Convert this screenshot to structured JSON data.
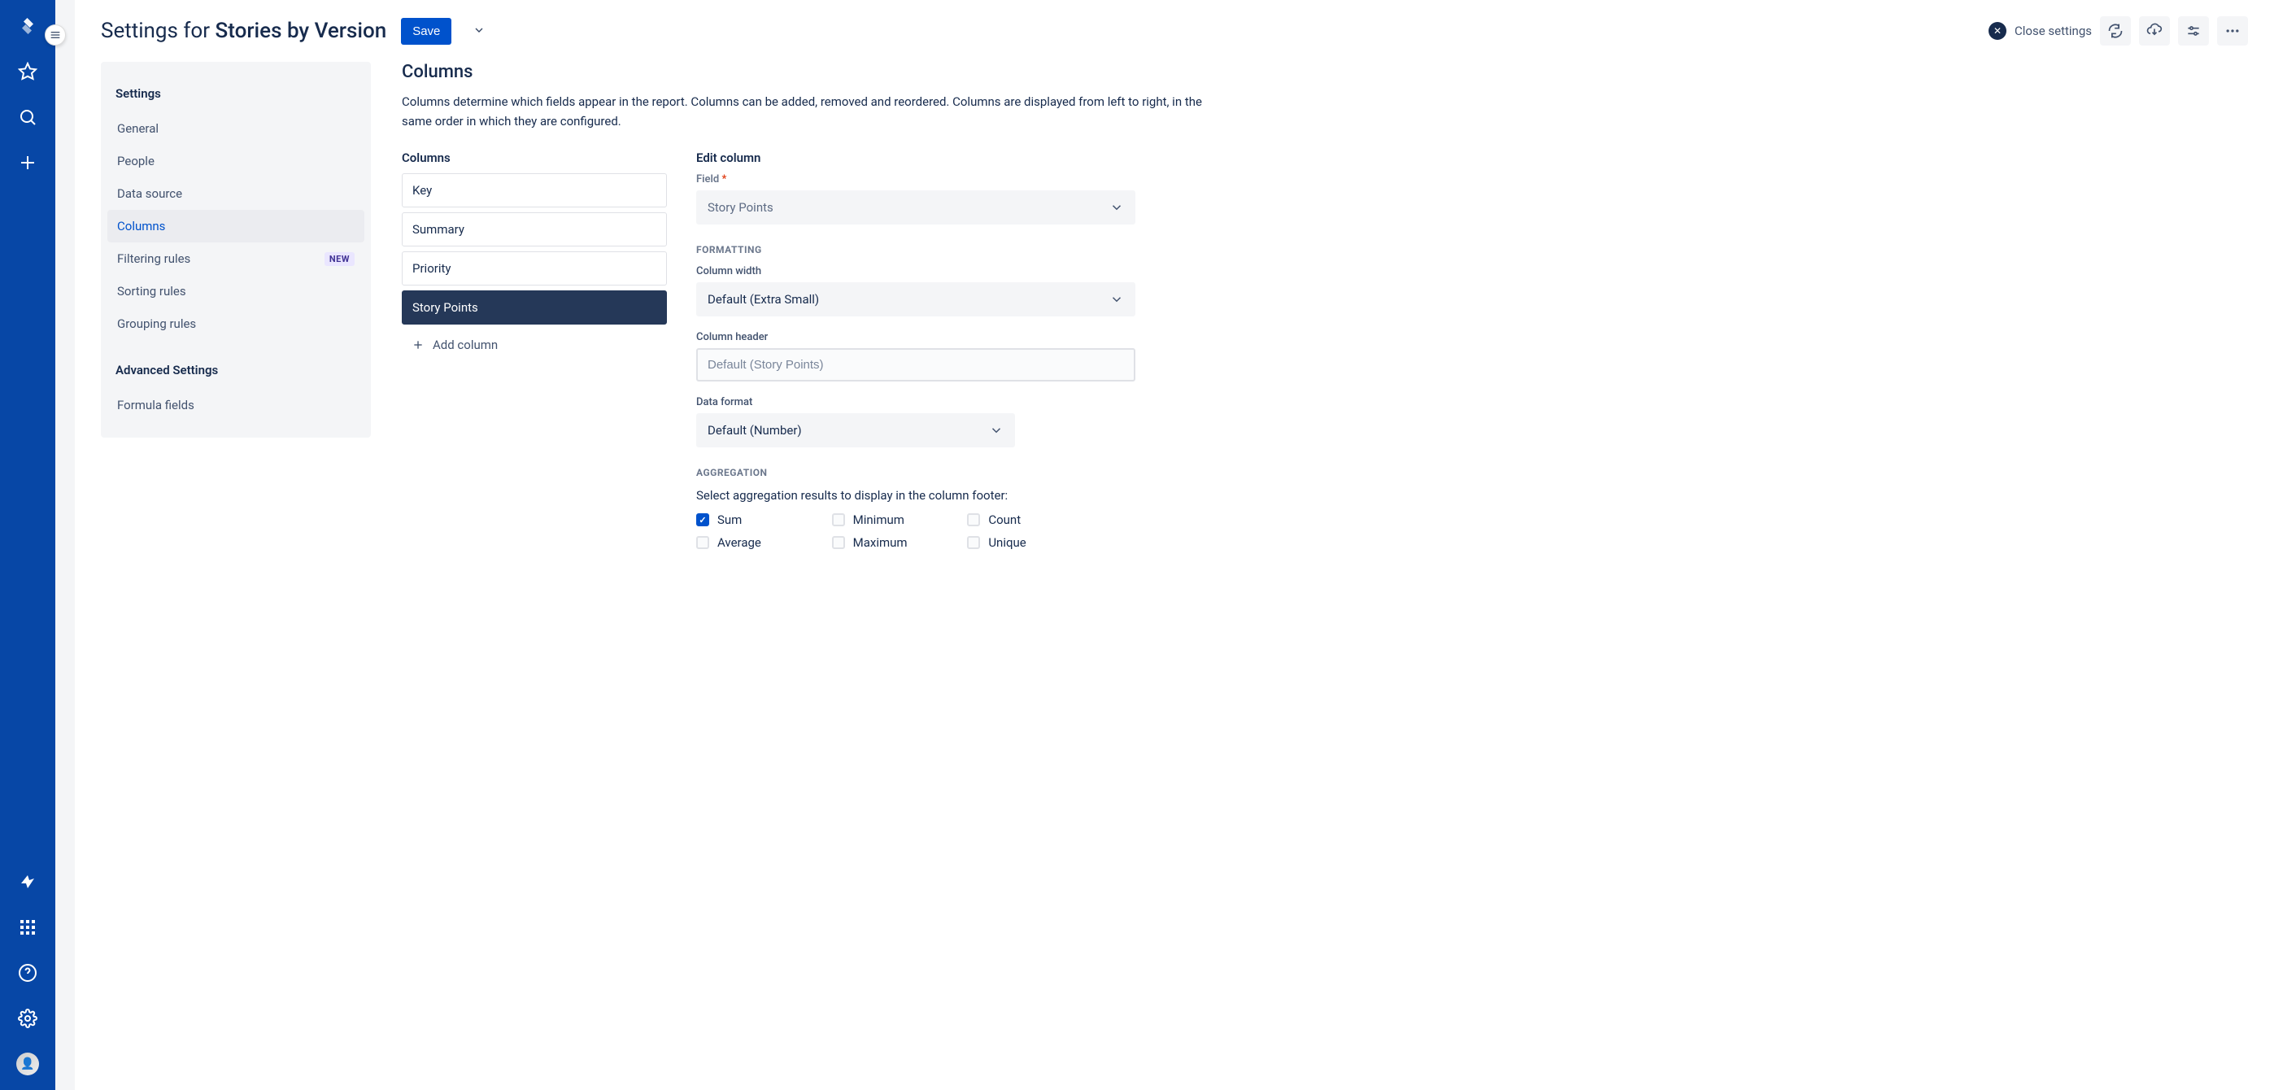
{
  "header": {
    "title_prefix": "Settings for ",
    "title_name": "Stories by Version",
    "save_label": "Save",
    "close_label": "Close settings"
  },
  "sidebar_collapse_icon": "menu",
  "settings_nav": {
    "heading1": "Settings",
    "items1": [
      {
        "label": "General"
      },
      {
        "label": "People"
      },
      {
        "label": "Data source"
      },
      {
        "label": "Columns",
        "active": true
      },
      {
        "label": "Filtering rules",
        "badge": "NEW"
      },
      {
        "label": "Sorting rules"
      },
      {
        "label": "Grouping rules"
      }
    ],
    "heading2": "Advanced Settings",
    "items2": [
      {
        "label": "Formula fields"
      }
    ]
  },
  "columns_section": {
    "heading": "Columns",
    "description": "Columns determine which fields appear in the report. Columns can be added, removed and reordered. Columns are displayed from left to right, in the same order in which they are configured.",
    "list_heading": "Columns",
    "columns": [
      {
        "label": "Key"
      },
      {
        "label": "Summary"
      },
      {
        "label": "Priority"
      },
      {
        "label": "Story Points",
        "selected": true
      }
    ],
    "add_label": "Add column"
  },
  "edit_column": {
    "heading": "Edit column",
    "field_label": "Field",
    "field_value": "Story Points",
    "formatting_heading": "FORMATTING",
    "width_label": "Column width",
    "width_value": "Default (Extra Small)",
    "header_label": "Column header",
    "header_placeholder": "Default (Story Points)",
    "dataformat_label": "Data format",
    "dataformat_value": "Default (Number)",
    "aggregation_heading": "AGGREGATION",
    "aggregation_sub": "Select aggregation results to display in the column footer:",
    "aggregations": [
      {
        "label": "Sum",
        "checked": true
      },
      {
        "label": "Minimum",
        "checked": false
      },
      {
        "label": "Count",
        "checked": false
      },
      {
        "label": "Average",
        "checked": false
      },
      {
        "label": "Maximum",
        "checked": false
      },
      {
        "label": "Unique",
        "checked": false
      }
    ]
  }
}
